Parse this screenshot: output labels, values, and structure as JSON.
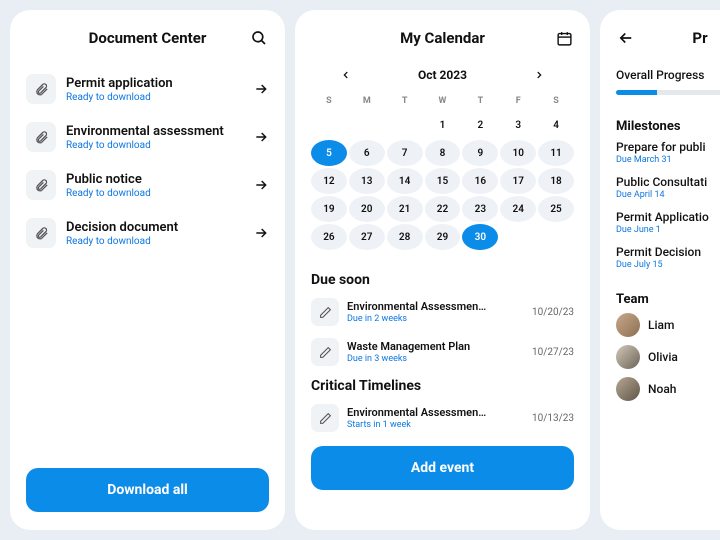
{
  "doc": {
    "title": "Document Center",
    "items": [
      {
        "name": "Permit application",
        "sub": "Ready to download"
      },
      {
        "name": "Environmental assessment",
        "sub": "Ready to download"
      },
      {
        "name": "Public notice",
        "sub": "Ready to download"
      },
      {
        "name": "Decision document",
        "sub": "Ready to download"
      }
    ],
    "button": "Download all"
  },
  "cal": {
    "title": "My Calendar",
    "month": "Oct 2023",
    "dow": [
      "S",
      "M",
      "T",
      "W",
      "T",
      "F",
      "S"
    ],
    "due_title": "Due soon",
    "due": [
      {
        "name": "Environmental Assessmen…",
        "sub": "Due in 2 weeks",
        "date": "10/20/23"
      },
      {
        "name": "Waste Management Plan",
        "sub": "Due in 3 weeks",
        "date": "10/27/23"
      }
    ],
    "crit_title": "Critical Timelines",
    "crit": [
      {
        "name": "Environmental Assessmen…",
        "sub": "Starts in 1 week",
        "date": "10/13/23"
      }
    ],
    "button": "Add event"
  },
  "prog": {
    "title": "Pr",
    "overall": "Overall Progress",
    "ms_title": "Milestones",
    "ms": [
      {
        "name": "Prepare for publi",
        "due": "Due March 31"
      },
      {
        "name": "Public Consultati",
        "due": "Due April 14"
      },
      {
        "name": "Permit Applicatio",
        "due": "Due June 1"
      },
      {
        "name": "Permit Decision",
        "due": "Due July 15"
      }
    ],
    "team_title": "Team",
    "team": [
      "Liam",
      "Olivia",
      "Noah"
    ]
  }
}
